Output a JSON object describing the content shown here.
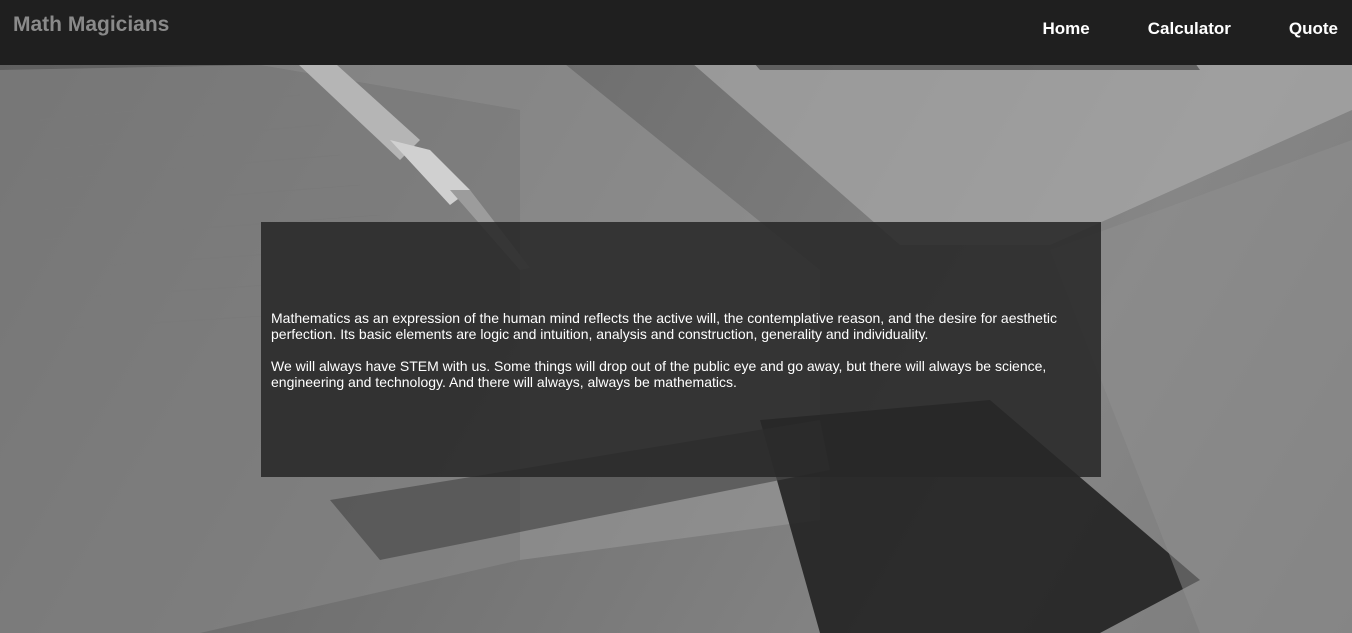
{
  "header": {
    "brand": "Math Magicians",
    "nav": [
      {
        "label": "Home"
      },
      {
        "label": "Calculator"
      },
      {
        "label": "Quote"
      }
    ]
  },
  "main": {
    "paragraphs": [
      "Mathematics as an expression of the human mind reflects the active will, the contemplative reason, and the desire for aesthetic perfection. Its basic elements are logic and intuition, analysis and construction, generality and individuality.",
      "We will always have STEM with us. Some things will drop out of the public eye and go away, but there will always be science, engineering and technology. And there will always, always be mathematics."
    ]
  },
  "colors": {
    "header_bg": "#1f1f1f",
    "brand_text": "#8a8a8a",
    "nav_text": "#ffffff",
    "panel_bg": "#282828"
  }
}
